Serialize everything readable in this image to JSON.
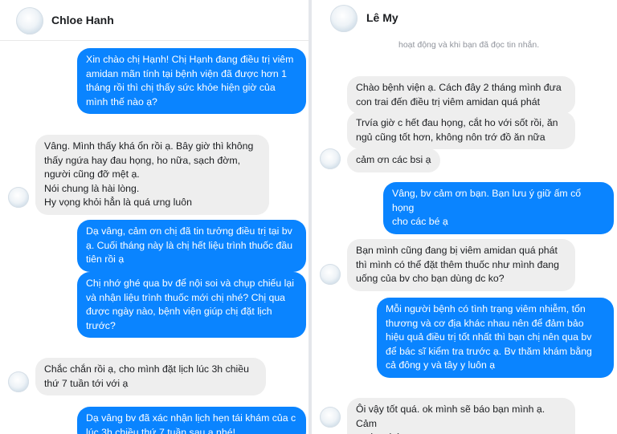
{
  "left_chat": {
    "contact_name": "Chloe Hanh",
    "messages": [
      {
        "dir": "out",
        "text": "Xin chào chị Hạnh! Chị Hạnh đang điều trị viêm\namidan mãn tính tại bệnh viện đã được hơn 1\ntháng rồi thì chị thấy sức khỏe hiện giờ của\nmình thế nào ạ?"
      },
      {
        "dir": "in",
        "text": "Vâng. Mình thấy khá ổn rồi ạ. Bây giờ thì không\nthấy ngứa hay đau họng, ho nữa, sạch đờm,\nngười cũng đỡ mệt ạ.\nNói chung là hài lòng.\nHy vọng khỏi hẳn là quá ưng luôn"
      },
      {
        "dir": "out",
        "text": "Dạ vâng, cảm ơn chị đã tin tưởng điều trị tại bv\nạ. Cuối tháng này là chị hết liệu trình thuốc đầu\ntiên rồi ạ"
      },
      {
        "dir": "out",
        "text": "Chị nhớ ghé qua bv để nội soi và chụp chiếu lại\nvà nhận liệu trình thuốc mới chị nhé? Chị qua\nđược ngày nào, bệnh viện giúp chị đặt lịch\ntrước?"
      },
      {
        "dir": "in",
        "text": "Chắc chắn rồi ạ, cho mình đặt lịch lúc 3h chiều\nthứ 7 tuần tới với ạ"
      },
      {
        "dir": "out",
        "text": "Dạ vâng bv đã xác nhận lịch hẹn tái khám của c\nlúc 3h chiều thứ 7 tuần sau ạ nhé!"
      }
    ]
  },
  "right_chat": {
    "contact_name": "Lê My",
    "status_text": "hoạt động và khi bạn đã đọc tin nhắn.",
    "messages": [
      {
        "dir": "in",
        "text": "Chào bệnh viện ạ. Cách đây 2 tháng mình đưa\ncon trai đến điều trị viêm amidan quá phát"
      },
      {
        "dir": "in",
        "text": "Trvía giờ c hết đau họng, cắt ho với sốt rồi, ăn\nngủ cũng tốt hơn, không nôn trớ đồ ăn nữa"
      },
      {
        "dir": "in",
        "text": "cảm ơn các bsi ạ"
      },
      {
        "dir": "out",
        "text": "Vâng, bv cảm ơn bạn. Bạn lưu ý giữ ấm cổ họng\ncho các bé ạ"
      },
      {
        "dir": "in",
        "text": "Bạn mình cũng đang bị viêm amidan quá phát\nthì mình có thể đặt thêm thuốc như mình đang\nuống của bv cho bạn dùng dc ko?"
      },
      {
        "dir": "out",
        "text": "Mỗi người bệnh có tình trạng viêm nhiễm, tổn\nthương và cơ địa khác nhau nên để đảm bảo\nhiệu quả điều trị tốt nhất thì bạn chị nên qua bv\nđể bác sĩ kiểm tra trước ạ. Bv thăm khám bằng\ncả đông y và tây y luôn ạ"
      },
      {
        "dir": "in",
        "text": "Ôi vậy tốt quá. ok mình sẽ báo bạn mình ạ. Cảm\nơn bv nhé"
      }
    ]
  },
  "colors": {
    "outgoing": "#0a84ff",
    "incoming": "#eeeeee"
  }
}
